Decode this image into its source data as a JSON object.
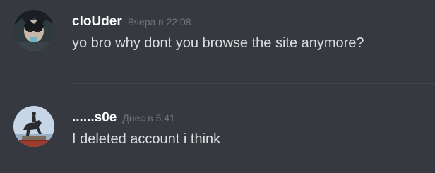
{
  "messages": [
    {
      "username": "cloUder",
      "timestamp": "Вчера в 22:08",
      "content": "yo bro why dont you browse the site anymore?",
      "avatar_icon": "anime-character-avatar-icon"
    },
    {
      "username": "......s0e",
      "timestamp": "Днес в 5:41",
      "content": "I deleted account i think",
      "avatar_icon": "equestrian-statue-avatar-icon"
    }
  ],
  "colors": {
    "background": "#36393f",
    "username": "#ffffff",
    "timestamp": "#72767d",
    "content": "#dcddde",
    "divider": "#42454a"
  }
}
